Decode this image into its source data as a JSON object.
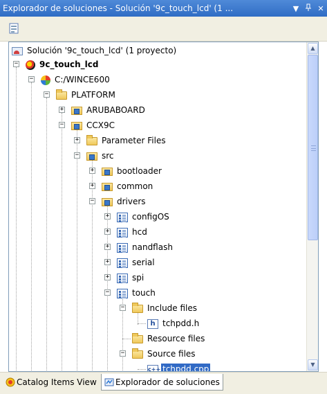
{
  "window": {
    "title": "Explorador de soluciones - Solución '9c_touch_lcd'  (1 ...",
    "dropdown_glyph": "▼",
    "pin_glyph": "ᵖ",
    "close_glyph": "✕"
  },
  "toolbar": {
    "properties_icon": "properties-icon"
  },
  "tree": {
    "solution": "Solución '9c_touch_lcd'  (1 proyecto)",
    "project": "9c_touch_lcd",
    "wince": "C:/WINCE600",
    "platform": "PLATFORM",
    "arubaboard": "ARUBABOARD",
    "ccx9c": "CCX9C",
    "parameter_files": "Parameter Files",
    "src": "src",
    "bootloader": "bootloader",
    "common": "common",
    "drivers": "drivers",
    "configos": "configOS",
    "hcd": "hcd",
    "nandflash": "nandflash",
    "serial": "serial",
    "spi": "spi",
    "touch": "touch",
    "include_files": "Include files",
    "tchpdd_h": "tchpdd.h",
    "resource_files": "Resource files",
    "source_files": "Source files",
    "tchpdd_cpp": "tchpdd.cpp"
  },
  "tabs": {
    "catalog": "Catalog Items View",
    "explorer": "Explorador de soluciones"
  },
  "expander": {
    "plus": "+",
    "minus": "−"
  }
}
